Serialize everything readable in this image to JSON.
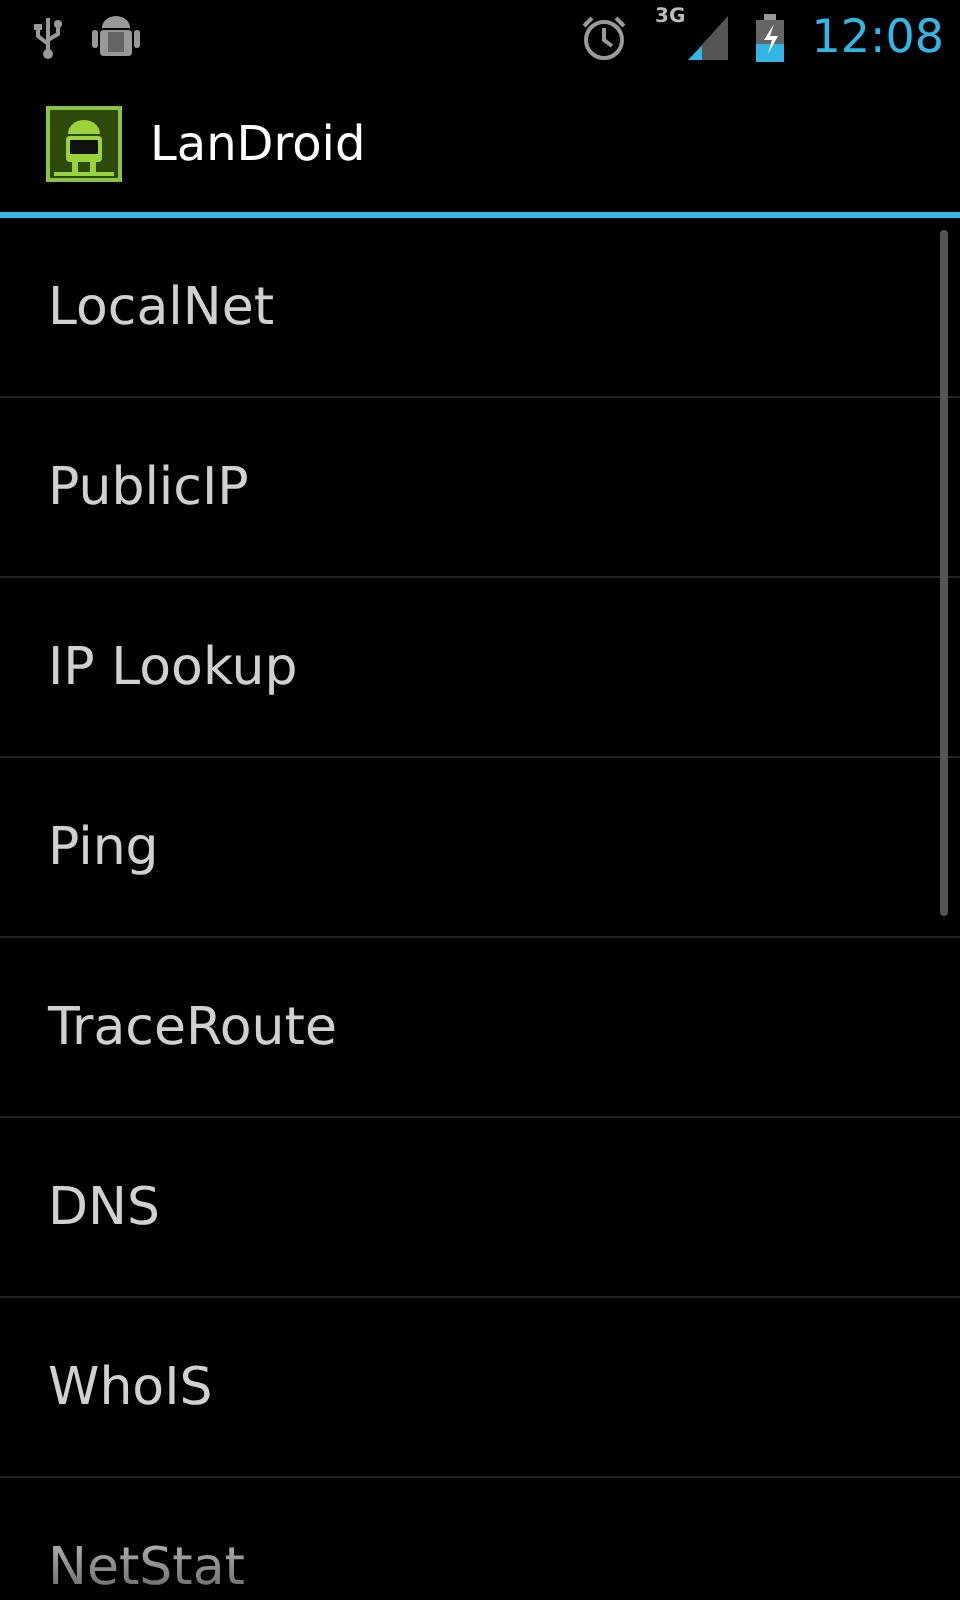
{
  "status_bar": {
    "network_type": "3G",
    "time": "12:08"
  },
  "action_bar": {
    "title": "LanDroid"
  },
  "menu": [
    {
      "label": "LocalNet"
    },
    {
      "label": "PublicIP"
    },
    {
      "label": "IP Lookup"
    },
    {
      "label": "Ping"
    },
    {
      "label": "TraceRoute"
    },
    {
      "label": "DNS"
    },
    {
      "label": "WhoIS"
    },
    {
      "label": "NetStat"
    }
  ]
}
